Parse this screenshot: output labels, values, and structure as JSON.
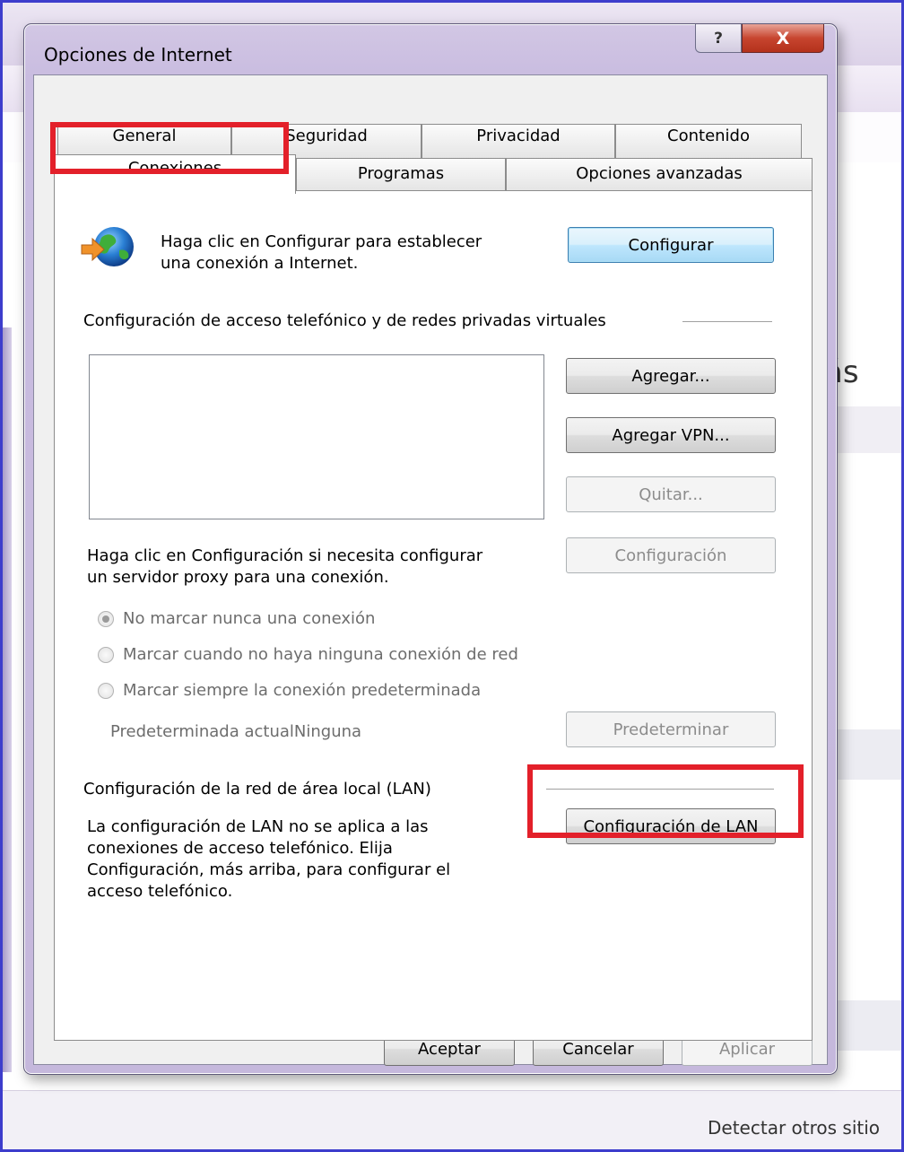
{
  "background": {
    "partial_heading": "ás",
    "partial_link": "Detectar otros sitio"
  },
  "dialog": {
    "title": "Opciones de Internet",
    "help_label": "?",
    "close_label": "X",
    "tabs_row1": [
      "General",
      "Seguridad",
      "Privacidad",
      "Contenido"
    ],
    "tabs_row2": [
      "Conexiones",
      "Programas",
      "Opciones avanzadas"
    ],
    "active_tab": "Conexiones",
    "setup": {
      "description_line1": "Haga clic en Configurar para establecer",
      "description_line2": "una conexión a Internet.",
      "button": "Configurar",
      "icon": "internet-connection-globe-icon"
    },
    "dialup": {
      "group_label": "Configuración de acceso telefónico y de redes privadas virtuales",
      "add_button": "Agregar...",
      "add_vpn_button": "Agregar VPN...",
      "remove_button": "Quitar...",
      "proxy_text_line1": "Haga clic en Configuración si necesita configurar",
      "proxy_text_line2": "un servidor proxy para una conexión.",
      "settings_button": "Configuración",
      "radio_options": [
        {
          "label": "No marcar nunca una conexión",
          "checked": true
        },
        {
          "label": "Marcar cuando no haya ninguna conexión de red",
          "checked": false
        },
        {
          "label": "Marcar siempre la conexión predeterminada",
          "checked": false
        }
      ],
      "current_default_label": "Predeterminada actual",
      "current_default_value": "Ninguna",
      "set_default_button": "Predeterminar"
    },
    "lan": {
      "group_label": "Configuración de la red de área local (LAN)",
      "text_line1": "La configuración de LAN no se aplica a las",
      "text_line2": "conexiones de acceso telefónico. Elija",
      "text_line3": "Configuración, más arriba, para configurar el",
      "text_line4": "acceso telefónico.",
      "button": "Configuración de LAN"
    },
    "footer": {
      "ok": "Aceptar",
      "cancel": "Cancelar",
      "apply": "Aplicar"
    }
  },
  "colors": {
    "highlight_box": "#e3202a",
    "frame_blue": "#3d3dcc"
  }
}
